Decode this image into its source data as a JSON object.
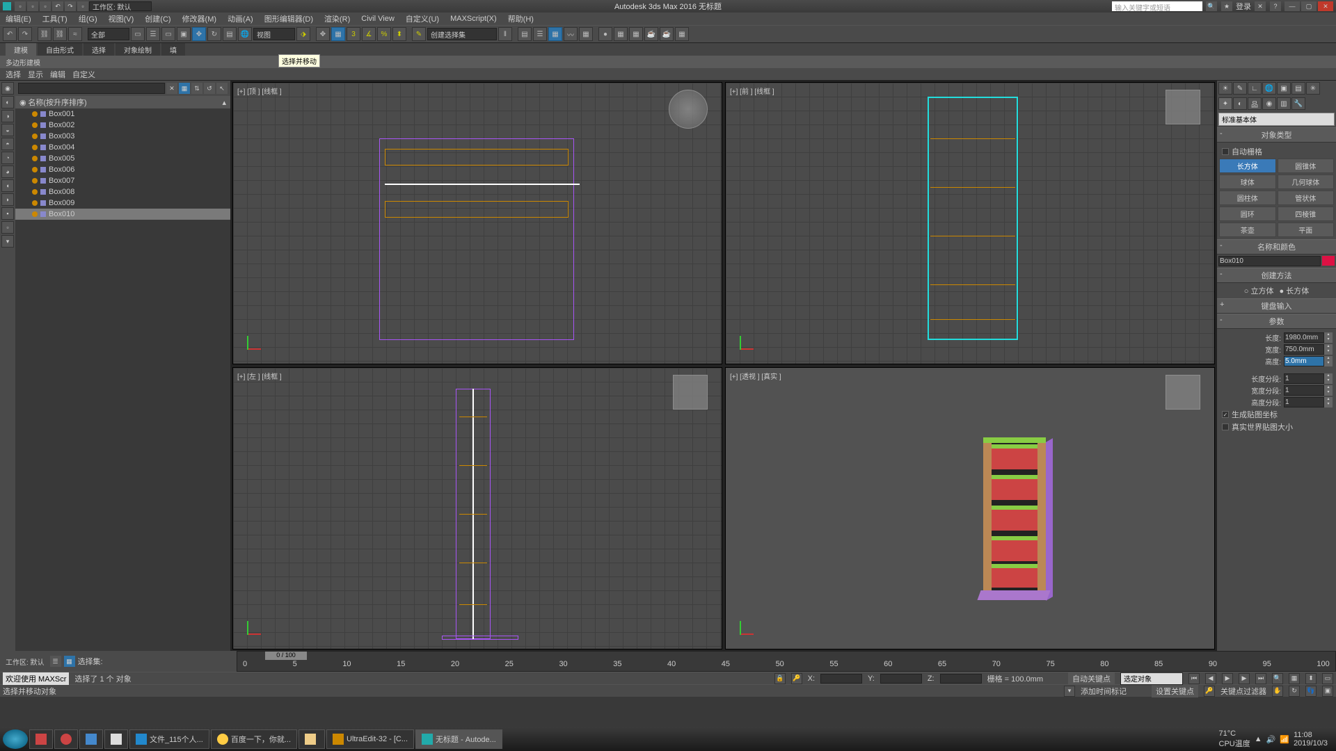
{
  "title": "Autodesk 3ds Max 2016   无标题",
  "workspace_label": "工作区: 默认",
  "search_placeholder": "输入关键字或短语",
  "login": "登录",
  "menu": [
    "编辑(E)",
    "工具(T)",
    "组(G)",
    "视图(V)",
    "创建(C)",
    "修改器(M)",
    "动画(A)",
    "图形编辑器(D)",
    "渲染(R)",
    "Civil View",
    "自定义(U)",
    "MAXScript(X)",
    "帮助(H)"
  ],
  "toolbar_all": "全部",
  "toolbar_view": "视图",
  "toolbar_selset": "创建选择集",
  "tooltip_move": "选择并移动",
  "ribtabs": [
    "建模",
    "自由形式",
    "选择",
    "对象绘制",
    "填"
  ],
  "ribsub": "多边形建模",
  "ribbar": [
    "选择",
    "显示",
    "编辑",
    "自定义"
  ],
  "scene_hdr": "名称(按升序排序)",
  "scene_items": [
    "Box001",
    "Box002",
    "Box003",
    "Box004",
    "Box005",
    "Box006",
    "Box007",
    "Box008",
    "Box009",
    "Box010"
  ],
  "vp": {
    "top": "[+] [顶 ] [线框 ]",
    "front": "[+] [前 ] [线框 ]",
    "left": "[+] [左 ] [线框 ]",
    "persp": "[+] [透视 ] [真实 ]"
  },
  "right": {
    "primitive_drop": "标准基本体",
    "roll_objtype": "对象类型",
    "auto_grid": "自动栅格",
    "prims": [
      "长方体",
      "圆锥体",
      "球体",
      "几何球体",
      "圆柱体",
      "管状体",
      "圆环",
      "四棱锥",
      "茶壶",
      "平面"
    ],
    "roll_name": "名称和颜色",
    "obj_name": "Box010",
    "roll_method": "创建方法",
    "method_cube": "立方体",
    "method_box": "长方体",
    "roll_kb": "键盘输入",
    "roll_params": "参数",
    "len": "长度:",
    "len_v": "1980.0mm",
    "wid": "宽度:",
    "wid_v": "750.0mm",
    "hei": "高度:",
    "hei_v": "5.0mm",
    "lseg": "长度分段:",
    "lseg_v": "1",
    "wseg": "宽度分段:",
    "wseg_v": "1",
    "hseg": "高度分段:",
    "hseg_v": "1",
    "gen_map": "生成贴图坐标",
    "real_world": "真实世界贴图大小"
  },
  "timeline": {
    "pos": "0 / 100",
    "ticks": [
      "0",
      "5",
      "10",
      "15",
      "20",
      "25",
      "30",
      "35",
      "40",
      "45",
      "50",
      "55",
      "60",
      "65",
      "70",
      "75",
      "80",
      "85",
      "90",
      "95",
      "100"
    ]
  },
  "status": {
    "ws": "工作区: 默认",
    "selset": "选择集:",
    "welcome": "欢迎使用 MAXScr",
    "sel": "选择了 1 个 对象",
    "prompt": "选择并移动对象",
    "grid": "栅格 = 100.0mm",
    "add_time": "添加时间标记",
    "autokey": "自动关键点",
    "setkey": "设置关键点",
    "keyfilter": "关键点过滤器",
    "seldrop": "选定对象"
  },
  "taskbar": {
    "items": [
      "文件_115个人...",
      "百度一下，你就...",
      "",
      "UltraEdit-32 - [C...",
      "无标题 - Autode..."
    ],
    "temp": "71°C",
    "cpu": "CPU温度",
    "time": "11:08",
    "date": "2019/10/3"
  }
}
